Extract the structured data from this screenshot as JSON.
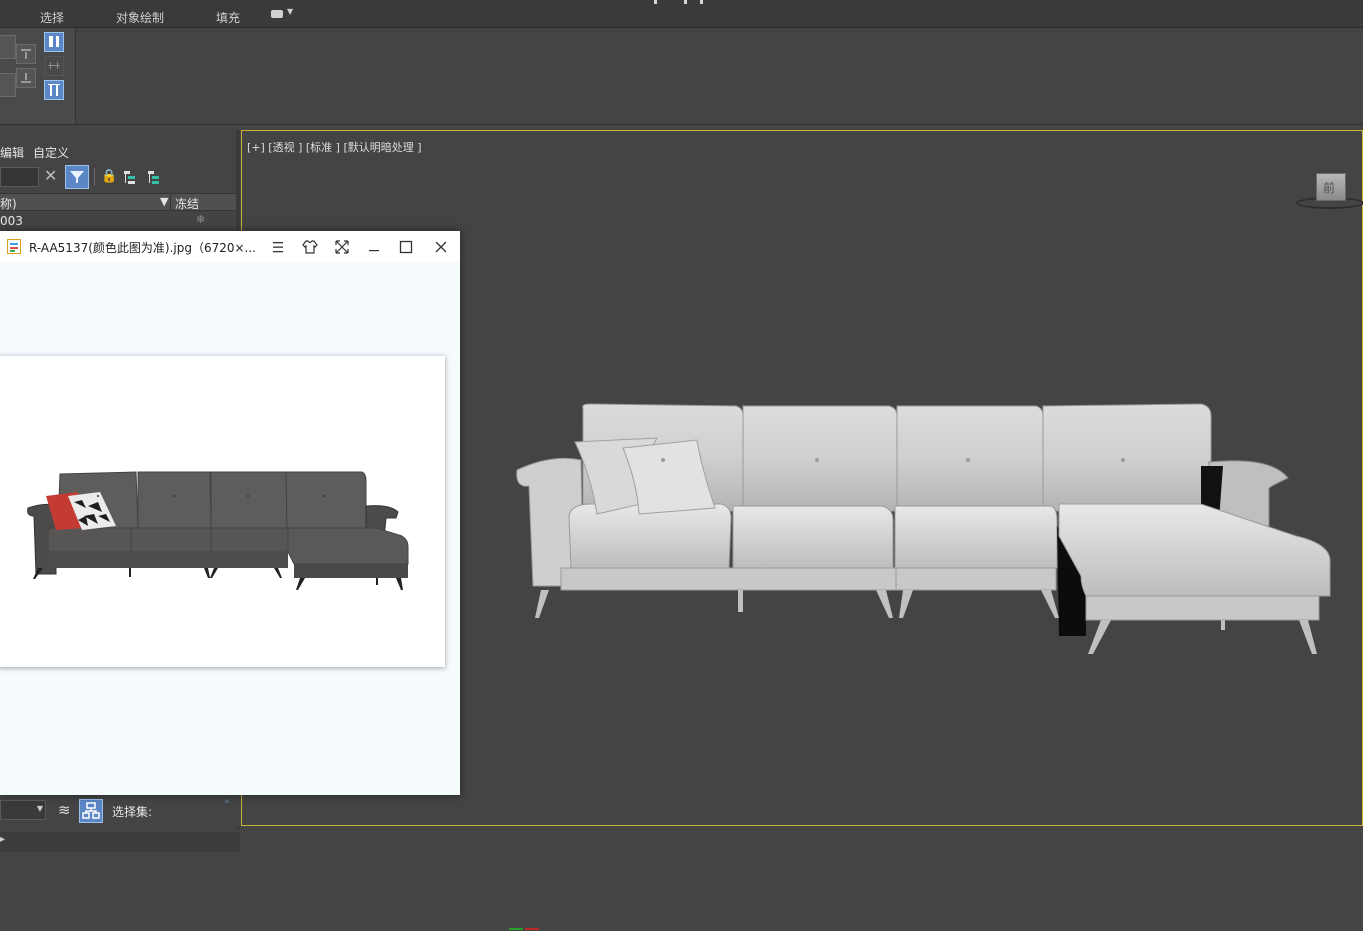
{
  "tabs": [
    {
      "label": "选择"
    },
    {
      "label": "对象绘制"
    },
    {
      "label": "填充"
    }
  ],
  "explorer": {
    "menu": [
      {
        "label": "编辑"
      },
      {
        "label": "自定义"
      }
    ],
    "column_name": "称)",
    "column_freeze": "冻结",
    "rows": [
      {
        "name": "003"
      }
    ],
    "selection_set_label": "选择集:"
  },
  "viewport": {
    "label": "[+] [透视 ] [标准 ] [默认明暗处理 ]",
    "viewcube_face": "前"
  },
  "viewer": {
    "title": "R-AA5137(颜色此图为准).jpg（6720×..."
  },
  "colors": {
    "accent": "#5b87c7",
    "viewport_border": "#c9b13a",
    "sofa_photo": "#565553",
    "pillow_red": "#c43b33"
  },
  "icons": [
    "menu-icon",
    "shirt-icon",
    "fullscreen-icon",
    "minimize-icon",
    "maximize-icon",
    "close-icon",
    "lock-icon",
    "filter-icon",
    "layers-icon",
    "hierarchy-icon"
  ]
}
